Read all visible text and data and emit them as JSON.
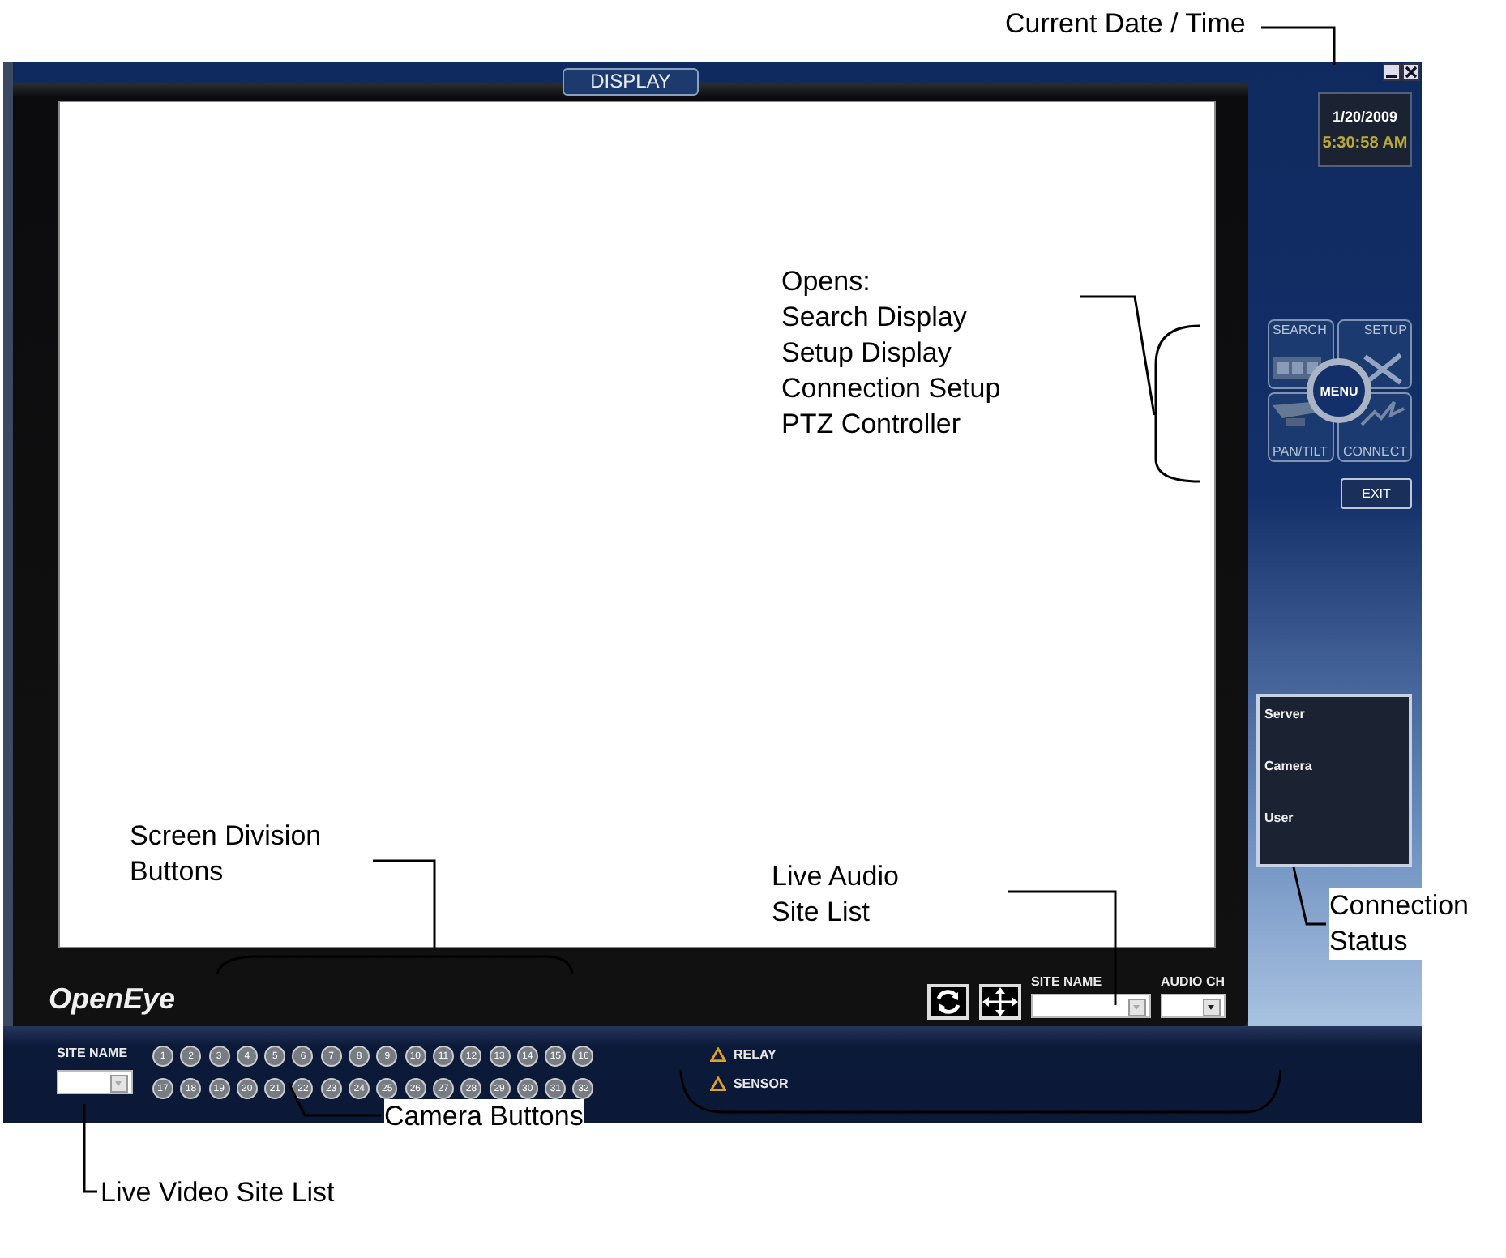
{
  "annotations": [
    {
      "lines": [
        "Current Date / Time"
      ]
    },
    {
      "lines": [
        "Opens:",
        "Search Display",
        "Setup Display",
        "Connection Setup",
        "PTZ Controller"
      ]
    },
    {
      "lines": [
        "Screen Division",
        "Buttons"
      ]
    },
    {
      "lines": [
        "Live Audio",
        "Site List"
      ]
    },
    {
      "lines": [
        "Connection",
        "Status"
      ]
    },
    {
      "lines": [
        "Camera Buttons"
      ]
    },
    {
      "lines": [
        "Live Video Site List"
      ]
    }
  ],
  "display_tab": "DISPLAY",
  "logo": "OpenEye",
  "datetime": {
    "date": "1/20/2009",
    "time": "5:30:58 AM"
  },
  "menu": {
    "center": "MENU",
    "tiles": [
      {
        "label": "SEARCH"
      },
      {
        "label": "SETUP"
      },
      {
        "label": "PAN/TILT"
      },
      {
        "label": "CONNECT"
      }
    ]
  },
  "exit_button": "EXIT",
  "connection_status": [
    "Server",
    "Camera",
    "User"
  ],
  "audio": {
    "site_label": "SITE NAME",
    "channel_label": "AUDIO CH"
  },
  "video": {
    "site_label": "SITE NAME",
    "camera_buttons": [
      "1",
      "2",
      "3",
      "4",
      "5",
      "6",
      "7",
      "8",
      "9",
      "10",
      "11",
      "12",
      "13",
      "14",
      "15",
      "16",
      "17",
      "18",
      "19",
      "20",
      "21",
      "22",
      "23",
      "24",
      "25",
      "26",
      "27",
      "28",
      "29",
      "30",
      "31",
      "32"
    ]
  },
  "alarms": [
    {
      "label": "RELAY"
    },
    {
      "label": "SENSOR"
    }
  ]
}
